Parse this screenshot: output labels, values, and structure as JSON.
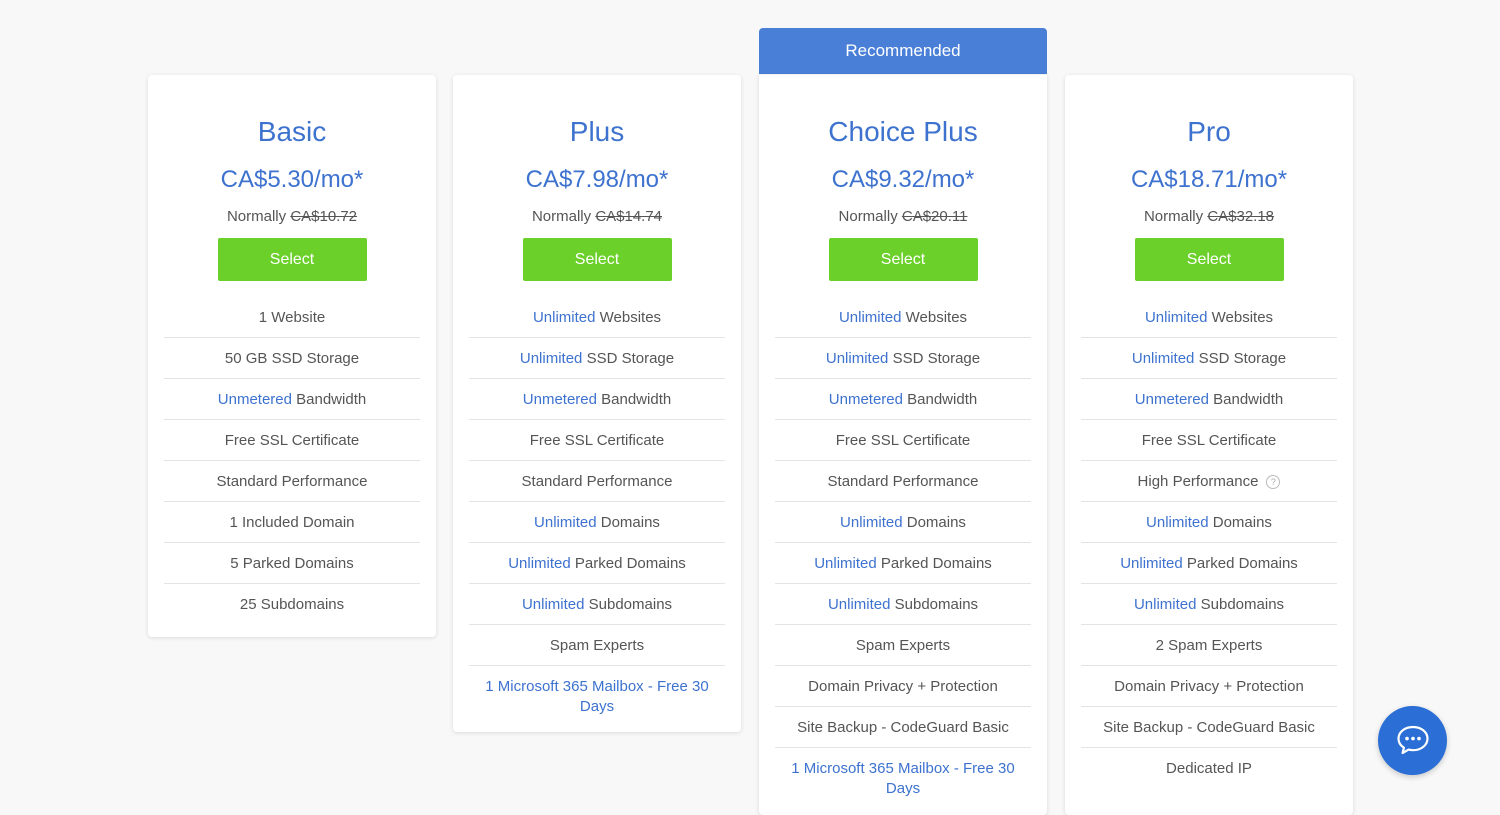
{
  "recommended_label": "Recommended",
  "select_label": "Select",
  "normally_label": "Normally",
  "plans": [
    {
      "name": "Basic",
      "price": "CA$5.30/mo*",
      "old_price": "CA$10.72",
      "features": [
        {
          "hl": "",
          "text": "1 Website"
        },
        {
          "hl": "",
          "text": "50 GB SSD Storage"
        },
        {
          "hl": "Unmetered",
          "text": " Bandwidth"
        },
        {
          "hl": "",
          "text": "Free SSL Certificate"
        },
        {
          "hl": "",
          "text": "Standard Performance"
        },
        {
          "hl": "",
          "text": "1 Included Domain"
        },
        {
          "hl": "",
          "text": "5 Parked Domains"
        },
        {
          "hl": "",
          "text": "25 Subdomains"
        }
      ]
    },
    {
      "name": "Plus",
      "price": "CA$7.98/mo*",
      "old_price": "CA$14.74",
      "features": [
        {
          "hl": "Unlimited",
          "text": " Websites"
        },
        {
          "hl": "Unlimited",
          "text": " SSD Storage"
        },
        {
          "hl": "Unmetered",
          "text": " Bandwidth"
        },
        {
          "hl": "",
          "text": "Free SSL Certificate"
        },
        {
          "hl": "",
          "text": "Standard Performance"
        },
        {
          "hl": "Unlimited",
          "text": " Domains"
        },
        {
          "hl": "Unlimited",
          "text": " Parked Domains"
        },
        {
          "hl": "Unlimited",
          "text": " Subdomains"
        },
        {
          "hl": "",
          "text": "Spam Experts"
        },
        {
          "hl": "1 Microsoft 365 Mailbox - Free 30 Days",
          "text": "",
          "link": true
        }
      ]
    },
    {
      "name": "Choice Plus",
      "price": "CA$9.32/mo*",
      "old_price": "CA$20.11",
      "features": [
        {
          "hl": "Unlimited",
          "text": " Websites"
        },
        {
          "hl": "Unlimited",
          "text": " SSD Storage"
        },
        {
          "hl": "Unmetered",
          "text": " Bandwidth"
        },
        {
          "hl": "",
          "text": "Free SSL Certificate"
        },
        {
          "hl": "",
          "text": "Standard Performance"
        },
        {
          "hl": "Unlimited",
          "text": " Domains"
        },
        {
          "hl": "Unlimited",
          "text": " Parked Domains"
        },
        {
          "hl": "Unlimited",
          "text": " Subdomains"
        },
        {
          "hl": "",
          "text": "Spam Experts"
        },
        {
          "hl": "",
          "text": "Domain Privacy + Protection"
        },
        {
          "hl": "",
          "text": "Site Backup - CodeGuard Basic"
        },
        {
          "hl": "1 Microsoft 365 Mailbox - Free 30 Days",
          "text": "",
          "link": true
        }
      ]
    },
    {
      "name": "Pro",
      "price": "CA$18.71/mo*",
      "old_price": "CA$32.18",
      "features": [
        {
          "hl": "Unlimited",
          "text": " Websites"
        },
        {
          "hl": "Unlimited",
          "text": " SSD Storage"
        },
        {
          "hl": "Unmetered",
          "text": " Bandwidth"
        },
        {
          "hl": "",
          "text": "Free SSL Certificate"
        },
        {
          "hl": "",
          "text": "High Performance",
          "help": true
        },
        {
          "hl": "Unlimited",
          "text": " Domains"
        },
        {
          "hl": "Unlimited",
          "text": " Parked Domains"
        },
        {
          "hl": "Unlimited",
          "text": " Subdomains"
        },
        {
          "hl": "",
          "text": "2 Spam Experts"
        },
        {
          "hl": "",
          "text": "Domain Privacy + Protection"
        },
        {
          "hl": "",
          "text": "Site Backup - CodeGuard Basic"
        },
        {
          "hl": "",
          "text": "Dedicated IP"
        }
      ]
    }
  ],
  "colors": {
    "accent": "#3d72cf",
    "banner": "#4a7fd8",
    "select_button": "#6cd02a",
    "chat_button": "#2a6ed6"
  },
  "icons": {
    "chat": "chat-bubble-icon",
    "help": "question-circle-icon"
  }
}
